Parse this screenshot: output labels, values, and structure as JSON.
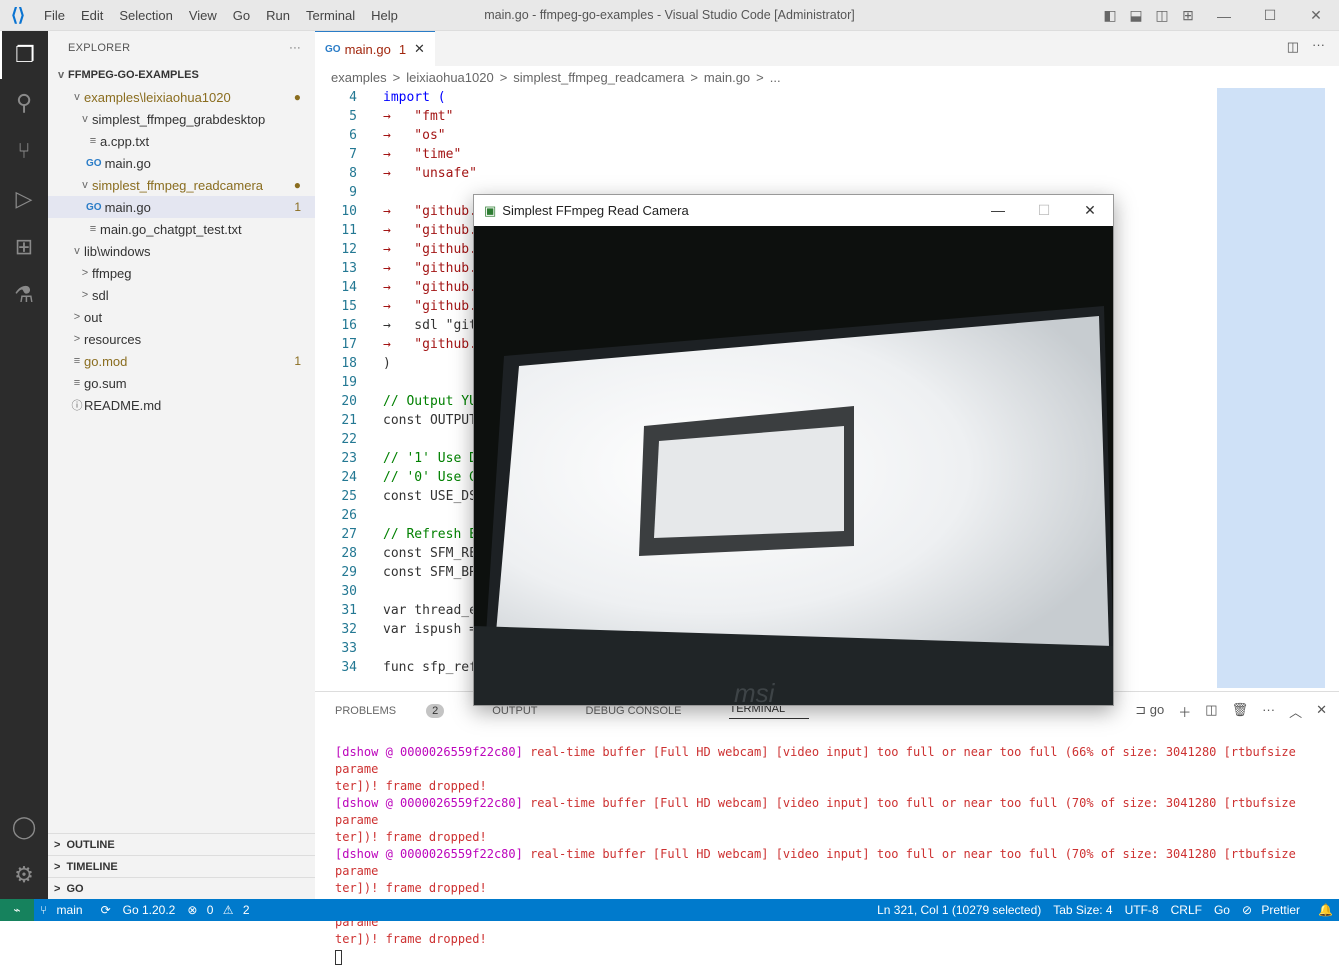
{
  "window": {
    "title": "main.go - ffmpeg-go-examples - Visual Studio Code [Administrator]",
    "menu": [
      "File",
      "Edit",
      "Selection",
      "View",
      "Go",
      "Run",
      "Terminal",
      "Help"
    ]
  },
  "explorer": {
    "title": "EXPLORER",
    "root": "FFMPEG-GO-EXAMPLES",
    "items": [
      {
        "label": "examples\\leixiaohua1020",
        "depth": 1,
        "chev": "v",
        "dot": true
      },
      {
        "label": "simplest_ffmpeg_grabdesktop",
        "depth": 2,
        "chev": "v"
      },
      {
        "label": "a.cpp.txt",
        "depth": 3,
        "icon": "≡"
      },
      {
        "label": "main.go",
        "depth": 3,
        "icon": "GO"
      },
      {
        "label": "simplest_ffmpeg_readcamera",
        "depth": 2,
        "chev": "v",
        "dot": true
      },
      {
        "label": "main.go",
        "depth": 3,
        "icon": "GO",
        "selected": true,
        "badge": "1"
      },
      {
        "label": "main.go_chatgpt_test.txt",
        "depth": 3,
        "icon": "≡"
      },
      {
        "label": "lib\\windows",
        "depth": 1,
        "chev": "v"
      },
      {
        "label": "ffmpeg",
        "depth": 2,
        "chev": ">"
      },
      {
        "label": "sdl",
        "depth": 2,
        "chev": ">"
      },
      {
        "label": "out",
        "depth": 1,
        "chev": ">"
      },
      {
        "label": "resources",
        "depth": 1,
        "chev": ">"
      },
      {
        "label": "go.mod",
        "depth": 1,
        "icon": "≡",
        "badge": "1",
        "modified": true
      },
      {
        "label": "go.sum",
        "depth": 1,
        "icon": "≡"
      },
      {
        "label": "README.md",
        "depth": 1,
        "icon": "ⓘ"
      }
    ],
    "sections": [
      "OUTLINE",
      "TIMELINE",
      "GO"
    ]
  },
  "editor": {
    "tab": {
      "label": "main.go",
      "problems": "1"
    },
    "breadcrumbs": [
      "examples",
      ">",
      "leixiaohua1020",
      ">",
      "simplest_ffmpeg_readcamera",
      ">",
      "main.go",
      ">",
      "..."
    ],
    "lines": [
      {
        "n": "4",
        "t": "import (",
        "c": "kw"
      },
      {
        "n": "5",
        "t": "→   \"fmt\"",
        "c": "str"
      },
      {
        "n": "6",
        "t": "→   \"os\"",
        "c": "str"
      },
      {
        "n": "7",
        "t": "→   \"time\"",
        "c": "str"
      },
      {
        "n": "8",
        "t": "→   \"unsafe\"",
        "c": "str"
      },
      {
        "n": "9",
        "t": "",
        "c": ""
      },
      {
        "n": "10",
        "t": "→   \"github.",
        "c": "str"
      },
      {
        "n": "11",
        "t": "→   \"github.",
        "c": "str"
      },
      {
        "n": "12",
        "t": "→   \"github.",
        "c": "str"
      },
      {
        "n": "13",
        "t": "→   \"github.",
        "c": "str"
      },
      {
        "n": "14",
        "t": "→   \"github.",
        "c": "str"
      },
      {
        "n": "15",
        "t": "→   \"github.",
        "c": "str"
      },
      {
        "n": "16",
        "t": "→   sdl \"git",
        "c": ""
      },
      {
        "n": "17",
        "t": "→   \"github.",
        "c": "str"
      },
      {
        "n": "18",
        "t": ")",
        "c": ""
      },
      {
        "n": "19",
        "t": "",
        "c": ""
      },
      {
        "n": "20",
        "t": "// Output YU",
        "c": "cm"
      },
      {
        "n": "21",
        "t": "const OUTPUT",
        "c": ""
      },
      {
        "n": "22",
        "t": "",
        "c": ""
      },
      {
        "n": "23",
        "t": "// '1' Use D",
        "c": "cm"
      },
      {
        "n": "24",
        "t": "// '0' Use G",
        "c": "cm"
      },
      {
        "n": "25",
        "t": "const USE_DS",
        "c": ""
      },
      {
        "n": "26",
        "t": "",
        "c": ""
      },
      {
        "n": "27",
        "t": "// Refresh E",
        "c": "cm"
      },
      {
        "n": "28",
        "t": "const SFM_RE",
        "c": ""
      },
      {
        "n": "29",
        "t": "const SFM_BR",
        "c": ""
      },
      {
        "n": "30",
        "t": "",
        "c": ""
      },
      {
        "n": "31",
        "t": "var thread_e",
        "c": ""
      },
      {
        "n": "32",
        "t": "var ispush =",
        "c": ""
      },
      {
        "n": "33",
        "t": "",
        "c": ""
      },
      {
        "n": "34",
        "t": "func sfp_ref",
        "c": ""
      }
    ]
  },
  "panel": {
    "tabs": [
      "PROBLEMS",
      "OUTPUT",
      "DEBUG CONSOLE",
      "TERMINAL"
    ],
    "problems_count": "2",
    "active": "TERMINAL",
    "shell": "go",
    "lines": [
      {
        "pre": "[dshow @ 0000026559f22c80]",
        "msg": " real-time buffer [Full HD webcam] [video input] too full or near too full (66% of size: 3041280 [rtbufsize parame",
        "cont": "ter])! frame dropped!"
      },
      {
        "pre": "[dshow @ 0000026559f22c80]",
        "msg": " real-time buffer [Full HD webcam] [video input] too full or near too full (70% of size: 3041280 [rtbufsize parame",
        "cont": "ter])! frame dropped!"
      },
      {
        "pre": "[dshow @ 0000026559f22c80]",
        "msg": " real-time buffer [Full HD webcam] [video input] too full or near too full (70% of size: 3041280 [rtbufsize parame",
        "cont": "ter])! frame dropped!"
      },
      {
        "pre": "[dshow @ 0000026559f22c80]",
        "msg": " real-time buffer [Full HD webcam] [video input] too full or near too full (64% of size: 3041280 [rtbufsize parame",
        "cont": "ter])! frame dropped!"
      }
    ]
  },
  "popup": {
    "title": "Simplest FFmpeg Read Camera",
    "cam_text": "msi"
  },
  "status": {
    "branch": "main",
    "go": "Go 1.20.2",
    "errors": "0",
    "warnings": "2",
    "position": "Ln 321, Col 1 (10279 selected)",
    "tabsize": "Tab Size: 4",
    "encoding": "UTF-8",
    "eol": "CRLF",
    "lang": "Go",
    "prettier": "Prettier"
  }
}
